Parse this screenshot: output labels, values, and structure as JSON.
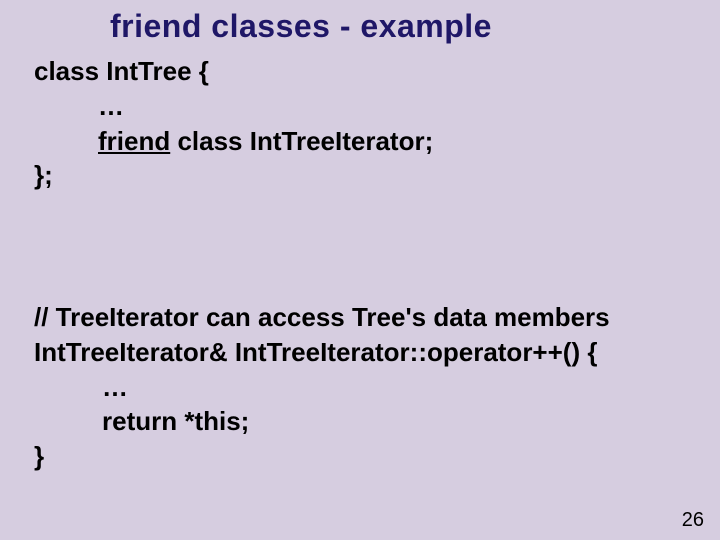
{
  "title": "friend classes - example",
  "code1": {
    "l1": "class IntTree {",
    "l2": "…",
    "l3_kw": "friend",
    "l3_rest": " class IntTreeIterator;",
    "l4": "};"
  },
  "code2": {
    "c1": "// TreeIterator can access Tree's data members",
    "c2": "IntTreeIterator& IntTreeIterator::operator++() {",
    "c3": "…",
    "c4": "return *this;",
    "c5": "}"
  },
  "pagenum": "26"
}
